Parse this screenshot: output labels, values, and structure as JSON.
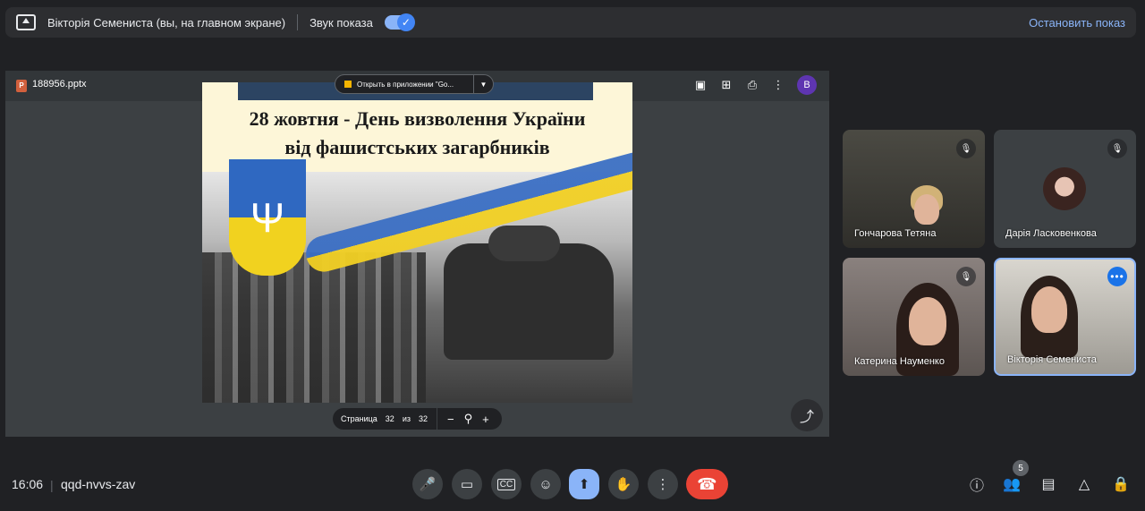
{
  "topbar": {
    "presenter": "Вікторія Семениста (вы, на главном экране)",
    "sound_label": "Звук показа",
    "stop_label": "Остановить показ"
  },
  "viewer": {
    "file_name": "188956.pptx",
    "avatar_letter": "B",
    "open_in_app": "Открыть в приложении \"Go...",
    "page_label": "Страница",
    "page_current": "32",
    "page_of": "из",
    "page_total": "32"
  },
  "slide": {
    "title_line1": "28 жовтня  -  День визволення України",
    "title_line2": "від фашистських загарбників"
  },
  "participants": [
    {
      "name": "Гончарова Тетяна",
      "muted": true
    },
    {
      "name": "Дарія Ласковенкова",
      "muted": true
    },
    {
      "name": "Катерина Науменко",
      "muted": true
    },
    {
      "name": "Вікторія Семениста",
      "muted": false
    }
  ],
  "footer": {
    "time": "16:06",
    "separator": "|",
    "meeting_code": "qqd-nvvs-zav",
    "people_count": "5"
  },
  "colors": {
    "accent": "#8ab4f8",
    "leave": "#ea4335",
    "background": "#202124"
  },
  "icons": [
    "present-icon",
    "mic-icon",
    "camera-icon",
    "captions-icon",
    "emoji-icon",
    "present-now-icon",
    "raise-hand-icon",
    "more-icon",
    "leave-call-icon",
    "info-icon",
    "people-icon",
    "chat-icon",
    "activities-icon",
    "host-controls-icon",
    "share-icon"
  ]
}
